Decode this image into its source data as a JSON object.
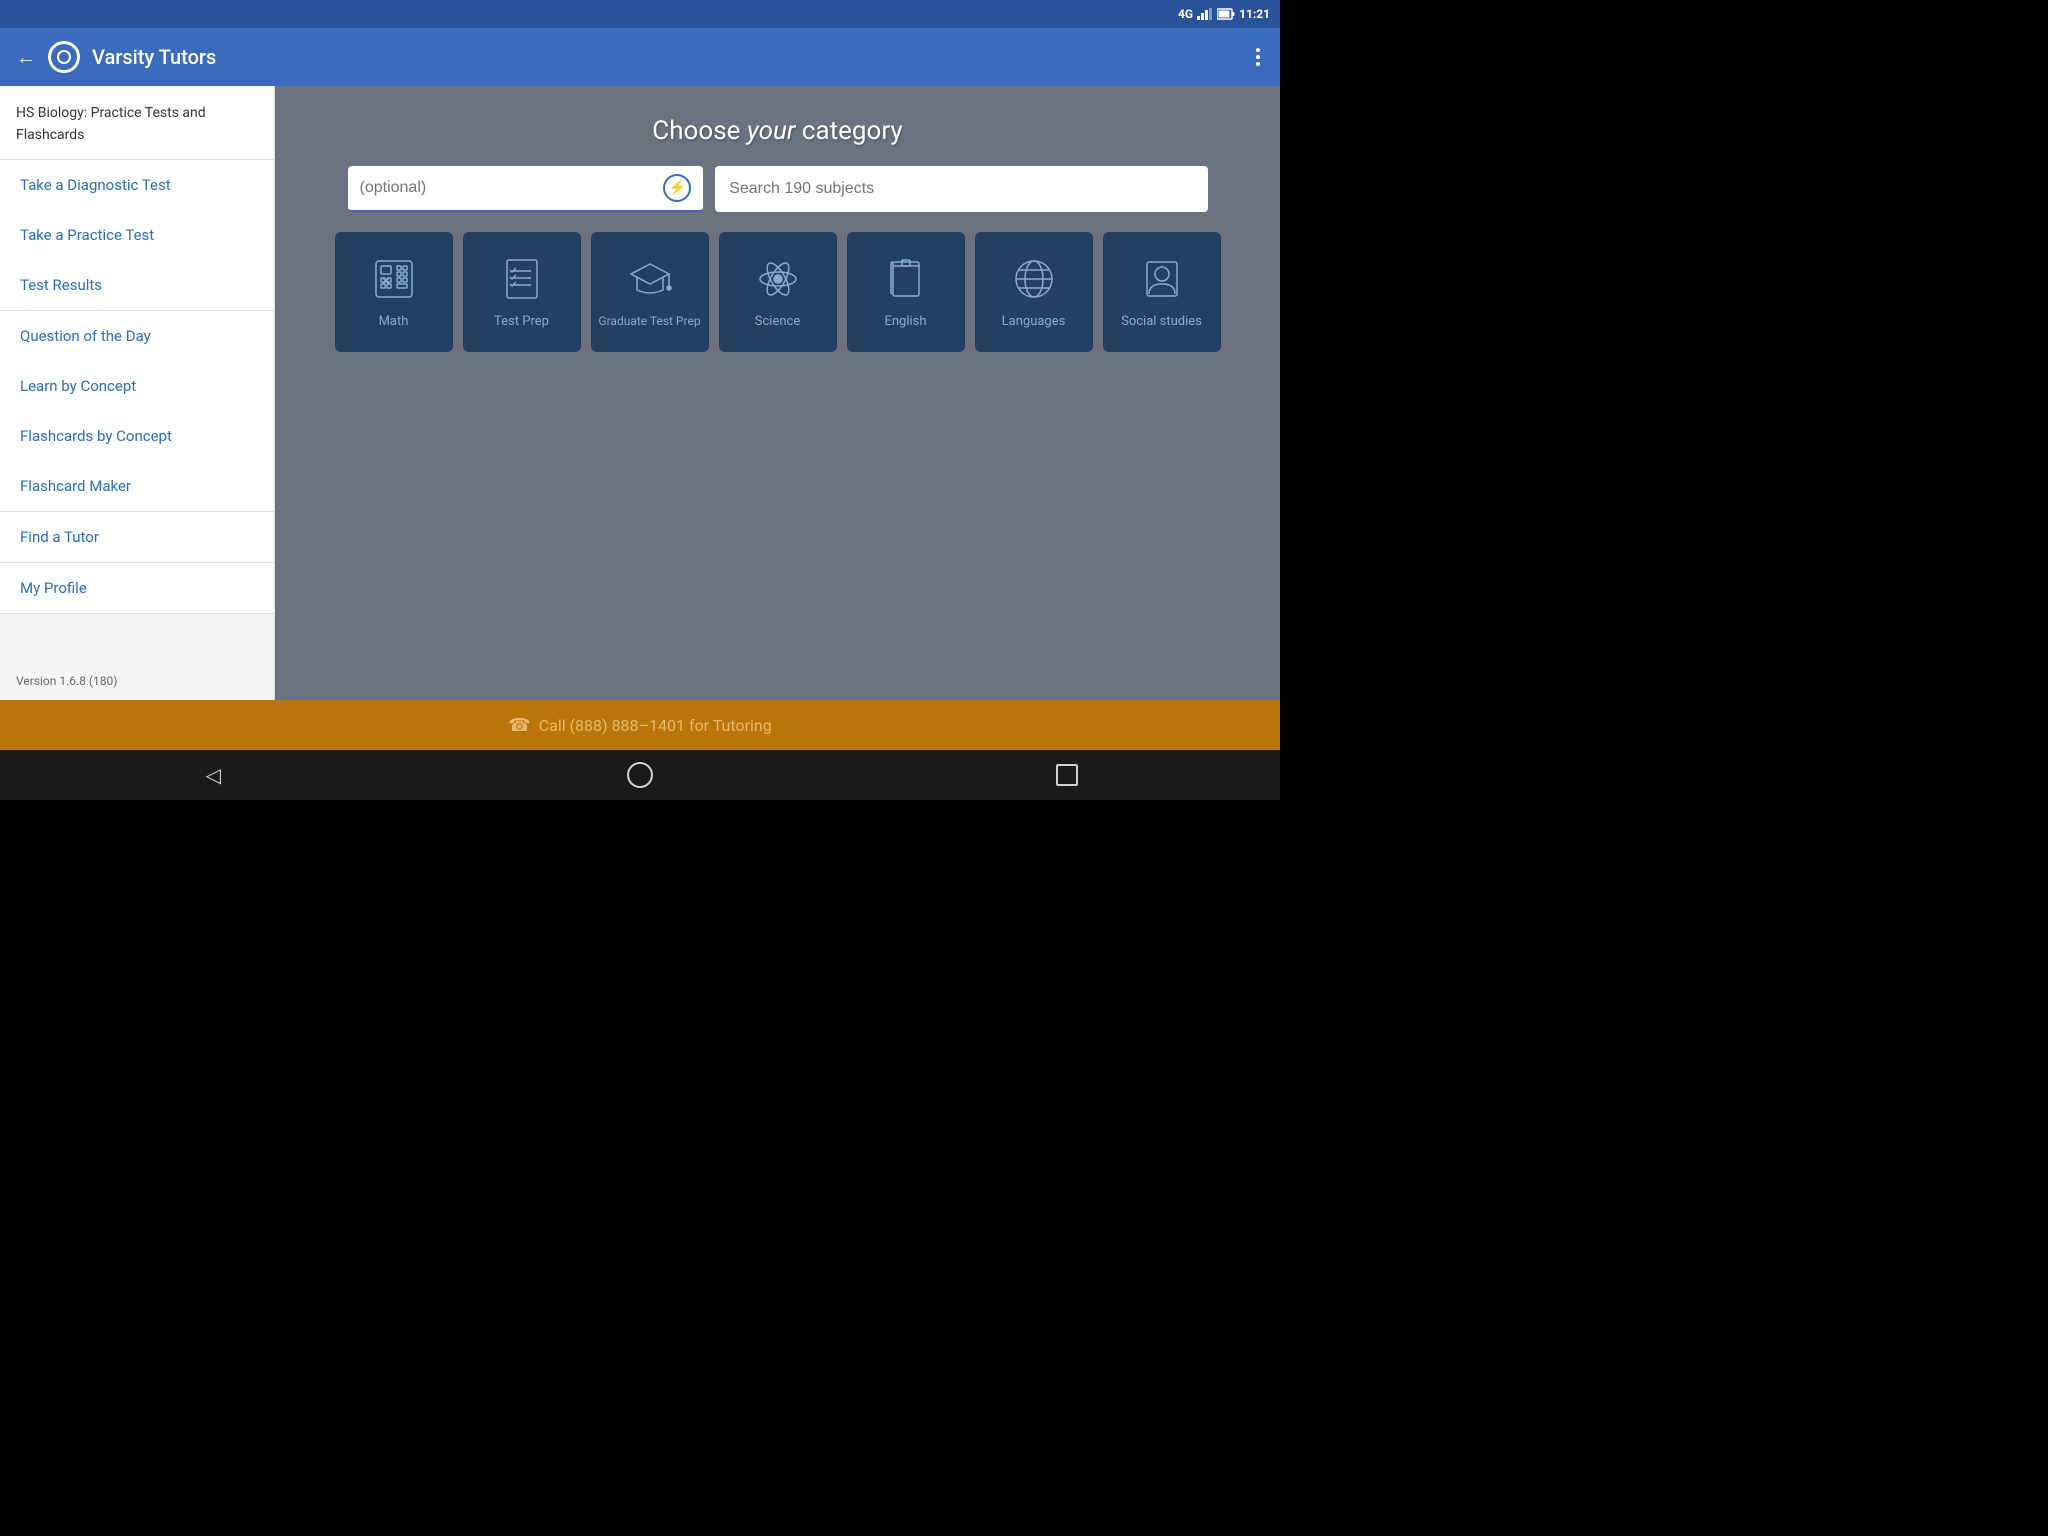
{
  "statusBar": {
    "network": "4G",
    "time": "11:21"
  },
  "appBar": {
    "title": "Varsity Tutors",
    "backLabel": "←",
    "moreLabel": "⋮"
  },
  "sidebar": {
    "headerText": "HS Biology: Practice Tests and Flashcards",
    "items": [
      {
        "id": "take-diagnostic",
        "label": "Take a Diagnostic Test"
      },
      {
        "id": "take-practice",
        "label": "Take a Practice Test"
      },
      {
        "id": "test-results",
        "label": "Test Results"
      },
      {
        "id": "question-of-day",
        "label": "Question of the Day"
      },
      {
        "id": "learn-by-concept",
        "label": "Learn by Concept"
      },
      {
        "id": "flashcards-by-concept",
        "label": "Flashcards by Concept"
      },
      {
        "id": "flashcard-maker",
        "label": "Flashcard Maker"
      },
      {
        "id": "find-tutor",
        "label": "Find a Tutor"
      },
      {
        "id": "my-profile",
        "label": "My Profile"
      }
    ],
    "version": "Version 1.6.8 (180)"
  },
  "content": {
    "title": "Choose ",
    "titleItalic": "your",
    "titleEnd": " category",
    "filterPlaceholder": "(optional)",
    "searchPlaceholder": "Search 190 subjects",
    "categories": [
      {
        "id": "math",
        "label": "Math",
        "icon": "calculator"
      },
      {
        "id": "test-prep",
        "label": "Test Prep",
        "icon": "checklist"
      },
      {
        "id": "graduate-test-prep",
        "label": "Graduate Test Prep",
        "icon": "graduation"
      },
      {
        "id": "science",
        "label": "Science",
        "icon": "atom"
      },
      {
        "id": "english",
        "label": "English",
        "icon": "book"
      },
      {
        "id": "languages",
        "label": "Languages",
        "icon": "globe"
      },
      {
        "id": "social-studies",
        "label": "Social studies",
        "icon": "person-book"
      }
    ]
  },
  "callBanner": {
    "text": "Call (888) 888–1401 for Tutoring"
  },
  "bottomNav": {
    "back": "◁",
    "home": "",
    "recent": ""
  }
}
